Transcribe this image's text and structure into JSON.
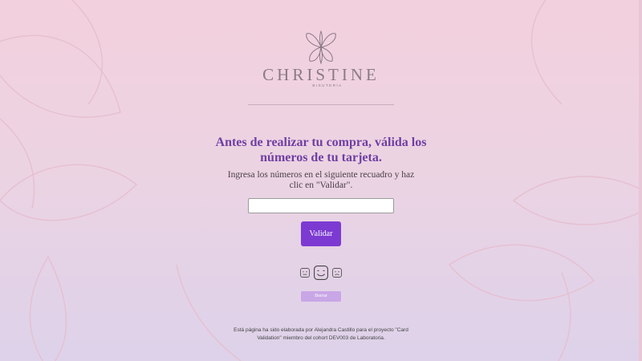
{
  "brand": {
    "name": "CHRISTINE",
    "subtitle": "BISUTERÍA"
  },
  "main": {
    "headline": "Antes de realizar tu compra, válida los números de tu tarjeta.",
    "instructions": "Ingresa los números en el siguiente recuadro y haz clic en \"Validar\".",
    "card_input": {
      "value": "",
      "placeholder": ""
    },
    "validate_label": "Validar",
    "clear_label": "Borrar",
    "faces": [
      "neutral-face-icon",
      "smile-face-icon",
      "sad-face-icon"
    ]
  },
  "footer": {
    "text": "Está página ha sido elaborada por Alejandra Castillo para el proyecto \"Card Validation\" miembro del cohort DEV003 de Laboratoria."
  },
  "colors": {
    "accent": "#7c3ad2",
    "headline": "#6f3fa3",
    "clear_button": "#c9a6e6",
    "bg_top": "#f3d0dd",
    "bg_bottom": "#ddd2ea"
  }
}
